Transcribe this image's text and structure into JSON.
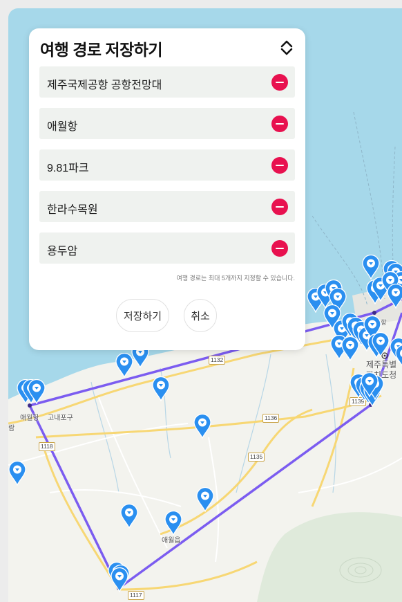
{
  "panel": {
    "title": "여행 경로 저장하기",
    "sort_icon": "sort-arrows-icon",
    "routes": [
      {
        "name": "제주국제공항 공항전망대"
      },
      {
        "name": "애월항"
      },
      {
        "name": "9.81파크"
      },
      {
        "name": "한라수목원"
      },
      {
        "name": "용두암"
      }
    ],
    "remove_icon": "minus-circle-icon",
    "notice": "여행 경로는 최대 5개까지 지정할 수 있습니다.",
    "save_label": "저장하기",
    "cancel_label": "취소"
  },
  "map": {
    "labels": {
      "aewol_port": "애월항",
      "gonae_port": "고내포구",
      "airport": "제주국제공항",
      "jeju_special": "제주특별",
      "provincial_office": "자치도청",
      "aewol_eup": "애월읍",
      "partial_left": "람"
    },
    "road_numbers": [
      "1132",
      "1136",
      "1135",
      "1139",
      "1118",
      "1117"
    ],
    "colors": {
      "sea": "#a6d8ea",
      "land": "#f3f3ee",
      "route_line": "#7b5cf0",
      "marker": "#2a8ff0",
      "remove": "#e8114f"
    },
    "marker_icon": "map-pin-icon"
  }
}
